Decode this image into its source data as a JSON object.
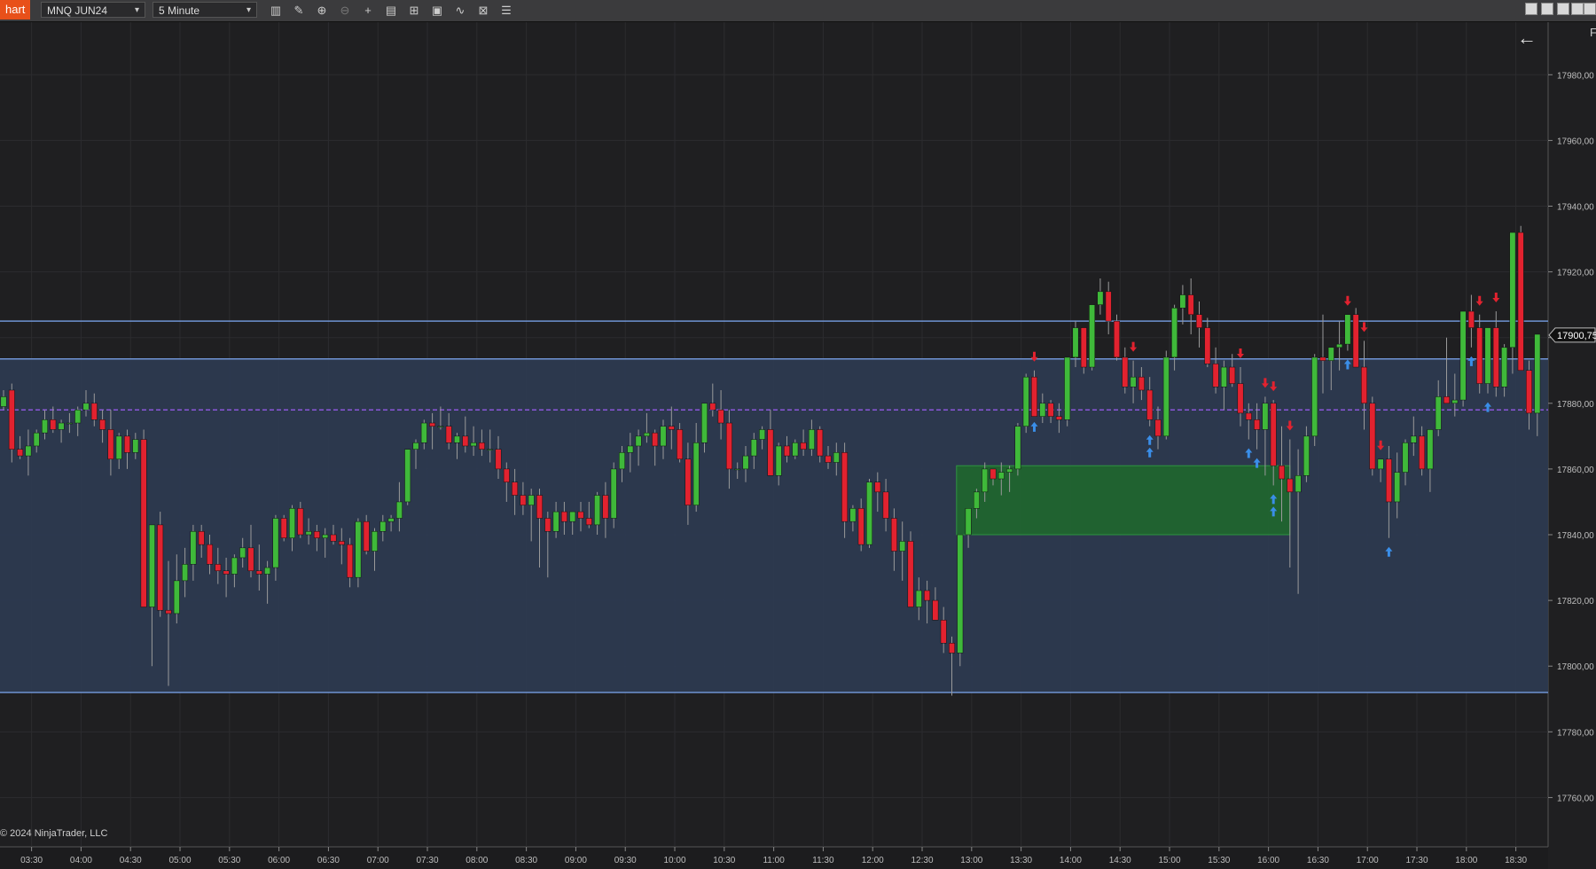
{
  "toolbar": {
    "tab_label": "hart",
    "instrument": "MNQ JUN24",
    "interval": "5 Minute",
    "tools": [
      "bars-icon",
      "pencil-icon",
      "zoom-in-icon",
      "zoom-out-icon",
      "crosshair-icon",
      "properties-icon",
      "data-box-icon",
      "strategies-icon",
      "indicators-icon",
      "alerts-icon",
      "list-icon"
    ]
  },
  "chart": {
    "copyright": "© 2024 NinjaTrader, LLC",
    "price_badge": "17900,75",
    "corner_label": "F",
    "back_arrow": "←",
    "colors": {
      "up": "#3fb93a",
      "down": "#e2222f",
      "zone": "#2e3b52",
      "zone_line": "#6f93d3",
      "pivot_line": "#8a56d9",
      "demand": "#1f6a2c",
      "arrow_up": "#3a8ee8",
      "arrow_down": "#e2222f"
    }
  },
  "chart_data": {
    "type": "candlestick",
    "symbol": "MNQ JUN24",
    "interval": "5 Minute",
    "ylim": [
      17745,
      17996
    ],
    "y_ticks": [
      "17980,00",
      "17960,00",
      "17940,00",
      "17920,00",
      "17900,00",
      "17880,00",
      "17860,00",
      "17840,00",
      "17820,00",
      "17800,00",
      "17780,00",
      "17760,00"
    ],
    "x_ticks": [
      "03:30",
      "04:00",
      "04:30",
      "05:00",
      "05:30",
      "06:00",
      "06:30",
      "07:00",
      "07:30",
      "08:00",
      "08:30",
      "09:00",
      "09:30",
      "10:00",
      "10:30",
      "11:00",
      "11:30",
      "12:00",
      "12:30",
      "13:00",
      "13:30",
      "14:00",
      "14:30",
      "15:00",
      "15:30",
      "16:00",
      "16:30",
      "17:00",
      "17:30",
      "18:00",
      "18:30"
    ],
    "horizontal_lines": [
      17905,
      17893.5,
      17878,
      17792
    ],
    "zone": {
      "top": 17893.5,
      "bottom": 17792
    },
    "demand_zone": {
      "top": 17861,
      "bottom": 17840
    },
    "last_price": 17900.75,
    "candles": [
      [
        17879,
        17884,
        17878,
        17882
      ],
      [
        17884,
        17886,
        17862,
        17866
      ],
      [
        17866,
        17870,
        17863,
        17864
      ],
      [
        17864,
        17872,
        17858,
        17867
      ],
      [
        17867,
        17872,
        17865,
        17871
      ],
      [
        17871,
        17878,
        17869,
        17875
      ],
      [
        17875,
        17879,
        17871,
        17872
      ],
      [
        17872,
        17875,
        17868,
        17874
      ],
      [
        17874,
        17877,
        17871,
        17874
      ],
      [
        17874,
        17879,
        17870,
        17878
      ],
      [
        17878,
        17884,
        17876,
        17880
      ],
      [
        17880,
        17883,
        17873,
        17875
      ],
      [
        17875,
        17878,
        17868,
        17872
      ],
      [
        17872,
        17878,
        17858,
        17863
      ],
      [
        17863,
        17871,
        17860,
        17870
      ],
      [
        17870,
        17872,
        17860,
        17865
      ],
      [
        17865,
        17871,
        17863,
        17869
      ],
      [
        17869,
        17872,
        17818,
        17818
      ],
      [
        17818,
        17842,
        17800,
        17843
      ],
      [
        17843,
        17847,
        17815,
        17817
      ],
      [
        17817,
        17832,
        17794,
        17816
      ],
      [
        17816,
        17834,
        17813,
        17826
      ],
      [
        17826,
        17836,
        17821,
        17831
      ],
      [
        17831,
        17843,
        17826,
        17841
      ],
      [
        17841,
        17843,
        17833,
        17837
      ],
      [
        17837,
        17840,
        17828,
        17831
      ],
      [
        17831,
        17836,
        17825,
        17829
      ],
      [
        17829,
        17833,
        17821,
        17828
      ],
      [
        17828,
        17834,
        17824,
        17833
      ],
      [
        17833,
        17839,
        17830,
        17836
      ],
      [
        17836,
        17843,
        17827,
        17829
      ],
      [
        17829,
        17837,
        17823,
        17828
      ],
      [
        17828,
        17832,
        17819,
        17830
      ],
      [
        17830,
        17846,
        17826,
        17845
      ],
      [
        17845,
        17846,
        17838,
        17839
      ],
      [
        17839,
        17849,
        17835,
        17848
      ],
      [
        17848,
        17850,
        17839,
        17840
      ],
      [
        17840,
        17845,
        17837,
        17841
      ],
      [
        17841,
        17843,
        17835,
        17839
      ],
      [
        17839,
        17842,
        17833,
        17840
      ],
      [
        17840,
        17843,
        17837,
        17838
      ],
      [
        17838,
        17842,
        17831,
        17837
      ],
      [
        17837,
        17839,
        17824,
        17827
      ],
      [
        17827,
        17845,
        17824,
        17844
      ],
      [
        17844,
        17846,
        17834,
        17835
      ],
      [
        17835,
        17842,
        17829,
        17841
      ],
      [
        17841,
        17846,
        17838,
        17844
      ],
      [
        17844,
        17846,
        17841,
        17845
      ],
      [
        17845,
        17856,
        17841,
        17850
      ],
      [
        17850,
        17866,
        17849,
        17866
      ],
      [
        17866,
        17869,
        17860,
        17868
      ],
      [
        17868,
        17875,
        17866,
        17874
      ],
      [
        17874,
        17877,
        17866,
        17873
      ],
      [
        17873,
        17879,
        17872,
        17873
      ],
      [
        17873,
        17877,
        17866,
        17868
      ],
      [
        17868,
        17871,
        17863,
        17870
      ],
      [
        17870,
        17876,
        17865,
        17867
      ],
      [
        17867,
        17873,
        17864,
        17868
      ],
      [
        17868,
        17872,
        17864,
        17866
      ],
      [
        17866,
        17872,
        17862,
        17866
      ],
      [
        17866,
        17870,
        17857,
        17860
      ],
      [
        17860,
        17862,
        17850,
        17856
      ],
      [
        17856,
        17860,
        17846,
        17852
      ],
      [
        17852,
        17856,
        17846,
        17849
      ],
      [
        17849,
        17854,
        17838,
        17852
      ],
      [
        17852,
        17854,
        17830,
        17845
      ],
      [
        17845,
        17847,
        17827,
        17841
      ],
      [
        17841,
        17850,
        17839,
        17847
      ],
      [
        17847,
        17850,
        17840,
        17844
      ],
      [
        17844,
        17847,
        17840,
        17847
      ],
      [
        17847,
        17850,
        17841,
        17845
      ],
      [
        17845,
        17850,
        17842,
        17843
      ],
      [
        17843,
        17853,
        17840,
        17852
      ],
      [
        17852,
        17856,
        17839,
        17845
      ],
      [
        17845,
        17862,
        17842,
        17860
      ],
      [
        17860,
        17867,
        17856,
        17865
      ],
      [
        17865,
        17871,
        17859,
        17867
      ],
      [
        17867,
        17872,
        17861,
        17870
      ],
      [
        17870,
        17877,
        17868,
        17871
      ],
      [
        17871,
        17872,
        17861,
        17867
      ],
      [
        17867,
        17875,
        17863,
        17873
      ],
      [
        17873,
        17879,
        17866,
        17872
      ],
      [
        17872,
        17874,
        17862,
        17863
      ],
      [
        17863,
        17868,
        17843,
        17849
      ],
      [
        17849,
        17874,
        17847,
        17868
      ],
      [
        17868,
        17879,
        17865,
        17880
      ],
      [
        17880,
        17886,
        17876,
        17878
      ],
      [
        17878,
        17884,
        17869,
        17874
      ],
      [
        17874,
        17878,
        17854,
        17860
      ],
      [
        17860,
        17862,
        17857,
        17860
      ],
      [
        17860,
        17867,
        17856,
        17864
      ],
      [
        17864,
        17871,
        17860,
        17869
      ],
      [
        17869,
        17873,
        17866,
        17872
      ],
      [
        17872,
        17878,
        17858,
        17858
      ],
      [
        17858,
        17868,
        17855,
        17867
      ],
      [
        17867,
        17870,
        17862,
        17864
      ],
      [
        17864,
        17869,
        17863,
        17868
      ],
      [
        17868,
        17872,
        17864,
        17866
      ],
      [
        17866,
        17875,
        17864,
        17872
      ],
      [
        17872,
        17873,
        17862,
        17864
      ],
      [
        17864,
        17867,
        17860,
        17862
      ],
      [
        17862,
        17868,
        17858,
        17865
      ],
      [
        17865,
        17868,
        17839,
        17844
      ],
      [
        17844,
        17849,
        17841,
        17848
      ],
      [
        17848,
        17851,
        17835,
        17837
      ],
      [
        17837,
        17857,
        17836,
        17856
      ],
      [
        17856,
        17859,
        17847,
        17853
      ],
      [
        17853,
        17857,
        17841,
        17845
      ],
      [
        17845,
        17848,
        17829,
        17835
      ],
      [
        17835,
        17844,
        17826,
        17838
      ],
      [
        17838,
        17841,
        17818,
        17818
      ],
      [
        17818,
        17827,
        17814,
        17823
      ],
      [
        17823,
        17826,
        17813,
        17820
      ],
      [
        17820,
        17824,
        17815,
        17814
      ],
      [
        17814,
        17818,
        17804,
        17807
      ],
      [
        17807,
        17809,
        17791,
        17804
      ],
      [
        17804,
        17840,
        17800,
        17840
      ],
      [
        17840,
        17848,
        17836,
        17848
      ],
      [
        17848,
        17854,
        17845,
        17853
      ],
      [
        17853,
        17862,
        17850,
        17860
      ],
      [
        17860,
        17860,
        17855,
        17857
      ],
      [
        17857,
        17862,
        17852,
        17859
      ],
      [
        17859,
        17861,
        17853,
        17860
      ],
      [
        17860,
        17874,
        17858,
        17873
      ],
      [
        17873,
        17889,
        17871,
        17888
      ],
      [
        17888,
        17890,
        17877,
        17876
      ],
      [
        17876,
        17883,
        17874,
        17880
      ],
      [
        17880,
        17881,
        17874,
        17876
      ],
      [
        17876,
        17880,
        17871,
        17875
      ],
      [
        17875,
        17893,
        17873,
        17894
      ],
      [
        17894,
        17905,
        17891,
        17903
      ],
      [
        17903,
        17903,
        17889,
        17891
      ],
      [
        17891,
        17910,
        17890,
        17910
      ],
      [
        17910,
        17918,
        17907,
        17914
      ],
      [
        17914,
        17917,
        17901,
        17905
      ],
      [
        17905,
        17907,
        17893,
        17894
      ],
      [
        17894,
        17897,
        17883,
        17885
      ],
      [
        17885,
        17893,
        17880,
        17888
      ],
      [
        17888,
        17891,
        17881,
        17884
      ],
      [
        17884,
        17888,
        17873,
        17875
      ],
      [
        17875,
        17879,
        17866,
        17870
      ],
      [
        17870,
        17896,
        17869,
        17894
      ],
      [
        17894,
        17910,
        17890,
        17909
      ],
      [
        17909,
        17916,
        17904,
        17913
      ],
      [
        17913,
        17918,
        17901,
        17907
      ],
      [
        17907,
        17911,
        17897,
        17903
      ],
      [
        17903,
        17906,
        17891,
        17892
      ],
      [
        17892,
        17897,
        17883,
        17885
      ],
      [
        17885,
        17893,
        17878,
        17891
      ],
      [
        17891,
        17895,
        17885,
        17886
      ],
      [
        17886,
        17891,
        17873,
        17877
      ],
      [
        17877,
        17880,
        17869,
        17875
      ],
      [
        17875,
        17880,
        17866,
        17872
      ],
      [
        17872,
        17882,
        17858,
        17880
      ],
      [
        17880,
        17881,
        17855,
        17861
      ],
      [
        17861,
        17873,
        17844,
        17857
      ],
      [
        17857,
        17869,
        17830,
        17853
      ],
      [
        17853,
        17866,
        17822,
        17858
      ],
      [
        17858,
        17873,
        17856,
        17870
      ],
      [
        17870,
        17895,
        17867,
        17894
      ],
      [
        17894,
        17907,
        17883,
        17893
      ],
      [
        17893,
        17897,
        17884,
        17897
      ],
      [
        17897,
        17905,
        17890,
        17898
      ],
      [
        17898,
        17907,
        17896,
        17907
      ],
      [
        17907,
        17909,
        17892,
        17891
      ],
      [
        17891,
        17899,
        17872,
        17880
      ],
      [
        17880,
        17882,
        17858,
        17860
      ],
      [
        17860,
        17863,
        17856,
        17863
      ],
      [
        17863,
        17867,
        17839,
        17850
      ],
      [
        17850,
        17865,
        17845,
        17859
      ],
      [
        17859,
        17869,
        17855,
        17868
      ],
      [
        17868,
        17876,
        17864,
        17870
      ],
      [
        17870,
        17873,
        17858,
        17860
      ],
      [
        17860,
        17872,
        17853,
        17872
      ],
      [
        17872,
        17887,
        17870,
        17882
      ],
      [
        17882,
        17900,
        17880,
        17880
      ],
      [
        17880,
        17889,
        17876,
        17881
      ],
      [
        17881,
        17908,
        17879,
        17908
      ],
      [
        17908,
        17913,
        17897,
        17903
      ],
      [
        17903,
        17907,
        17883,
        17886
      ],
      [
        17886,
        17898,
        17883,
        17903
      ],
      [
        17903,
        17908,
        17882,
        17885
      ],
      [
        17885,
        17898,
        17882,
        17897
      ],
      [
        17897,
        17917,
        17889,
        17932
      ],
      [
        17932,
        17934,
        17891,
        17890
      ],
      [
        17890,
        17893,
        17872,
        17877
      ],
      [
        17877,
        17899,
        17870,
        17901
      ]
    ],
    "markers": [
      {
        "type": "down",
        "index": 125
      },
      {
        "type": "up",
        "index": 125
      },
      {
        "type": "down",
        "index": 137
      },
      {
        "type": "up",
        "index": 139
      },
      {
        "type": "up",
        "index": 139
      },
      {
        "type": "down",
        "index": 150
      },
      {
        "type": "up",
        "index": 151
      },
      {
        "type": "up",
        "index": 152
      },
      {
        "type": "up",
        "index": 154
      },
      {
        "type": "down",
        "index": 153
      },
      {
        "type": "up",
        "index": 154
      },
      {
        "type": "down",
        "index": 154
      },
      {
        "type": "down",
        "index": 156
      },
      {
        "type": "up",
        "index": 163
      },
      {
        "type": "down",
        "index": 163
      },
      {
        "type": "down",
        "index": 165
      },
      {
        "type": "up",
        "index": 168
      },
      {
        "type": "down",
        "index": 167
      },
      {
        "type": "down",
        "index": 179
      },
      {
        "type": "up",
        "index": 178
      },
      {
        "type": "up",
        "index": 180
      },
      {
        "type": "down",
        "index": 181
      }
    ]
  }
}
